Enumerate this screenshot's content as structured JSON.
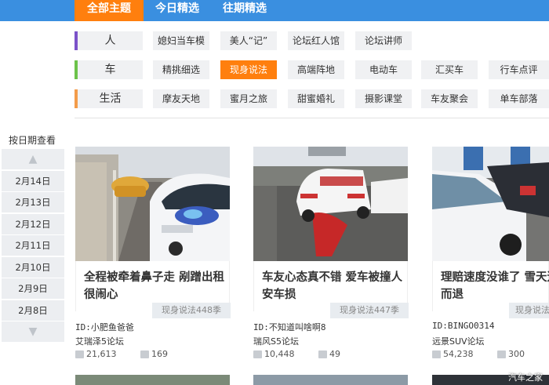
{
  "topnav": {
    "tabs": [
      {
        "label": "全部主题",
        "active": true
      },
      {
        "label": "今日精选",
        "active": false
      },
      {
        "label": "往期精选",
        "active": false
      }
    ]
  },
  "categories": [
    {
      "label": "人",
      "color": "#7b52c9",
      "items": [
        {
          "label": "媳妇当车模",
          "active": false
        },
        {
          "label": "美人“记”",
          "active": false
        },
        {
          "label": "论坛红人馆",
          "active": false
        },
        {
          "label": "论坛讲师",
          "active": false
        }
      ]
    },
    {
      "label": "车",
      "color": "#6cc24a",
      "items": [
        {
          "label": "精挑细选",
          "active": false
        },
        {
          "label": "现身说法",
          "active": true
        },
        {
          "label": "高端阵地",
          "active": false
        },
        {
          "label": "电动车",
          "active": false
        },
        {
          "label": "汇买车",
          "active": false
        },
        {
          "label": "行车点评",
          "active": false
        }
      ]
    },
    {
      "label": "生活",
      "color": "#f39c4a",
      "items": [
        {
          "label": "摩友天地",
          "active": false
        },
        {
          "label": "蜜月之旅",
          "active": false
        },
        {
          "label": "甜蜜婚礼",
          "active": false
        },
        {
          "label": "摄影课堂",
          "active": false
        },
        {
          "label": "车友聚会",
          "active": false
        },
        {
          "label": "单车部落",
          "active": false
        }
      ]
    }
  ],
  "date_nav": {
    "title": "按日期查看",
    "up_icon": "▲",
    "down_icon": "▼",
    "dates": [
      "2月14日",
      "2月13日",
      "2月12日",
      "2月11日",
      "2月10日",
      "2月9日",
      "2月8日"
    ]
  },
  "cards": [
    {
      "title": "全程被牵着鼻子走 剐蹭出租很闹心",
      "tag": "现身说法448季",
      "uid": "ID:小肥鱼爸爸",
      "forum": "艾瑞泽5论坛",
      "views": "21,613",
      "replies": "169"
    },
    {
      "title": "车友心态真不错 爱车被撞人安车损",
      "tag": "现身说法447季",
      "uid": "ID:不知道叫啥啊8",
      "forum": "瑞风S5论坛",
      "views": "10,448",
      "replies": "49"
    },
    {
      "title": "理赔速度没谁了 雪天追尾身而退",
      "tag": "现身说法",
      "uid": "ID:BINGO0314",
      "forum": "远景SUV论坛",
      "views": "54,238",
      "replies": "300"
    }
  ],
  "watermark": "汽车之家"
}
